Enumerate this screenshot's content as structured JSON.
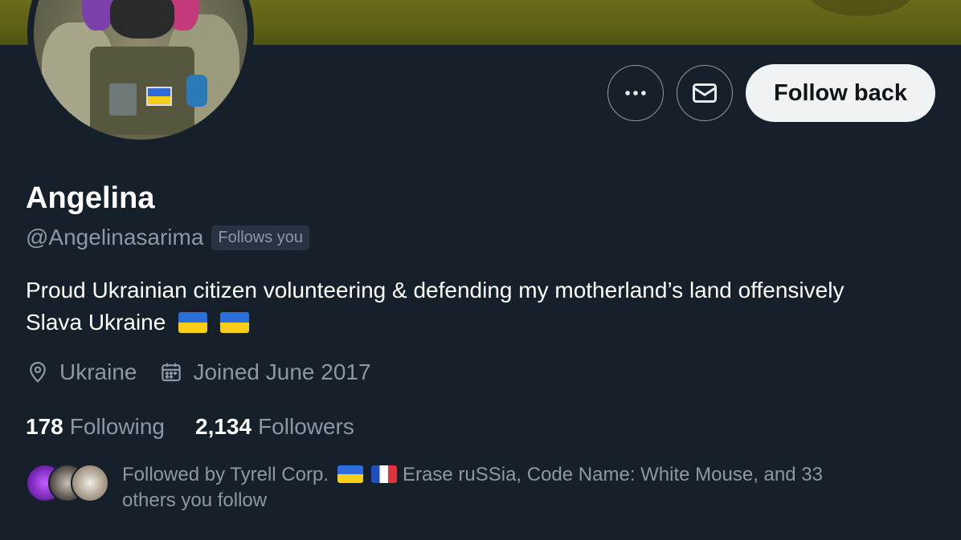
{
  "profile": {
    "name": "Angelina",
    "handle": "@Angelinasarima",
    "follows_you_badge": "Follows you",
    "bio_line1": "Proud Ukrainian citizen volunteering & defending my motherland’s land offensively",
    "bio_line2": "Slava Ukraine",
    "location": "Ukraine",
    "joined": "Joined June 2017",
    "following_count": "178",
    "following_label": "Following",
    "followers_count": "2,134",
    "followers_label": "Followers"
  },
  "actions": {
    "more_icon": "more-horizontal-icon",
    "message_icon": "envelope-icon",
    "follow_label": "Follow back"
  },
  "followed_by": {
    "prefix": "Followed by Tyrell Corp.",
    "middle": "Erase ruSSia, Code Name: White Mouse, and 33",
    "suffix": "others you follow"
  },
  "colors": {
    "background": "#15202b",
    "secondary_text": "#8b98a5",
    "follow_button_bg": "#eff3f4"
  }
}
